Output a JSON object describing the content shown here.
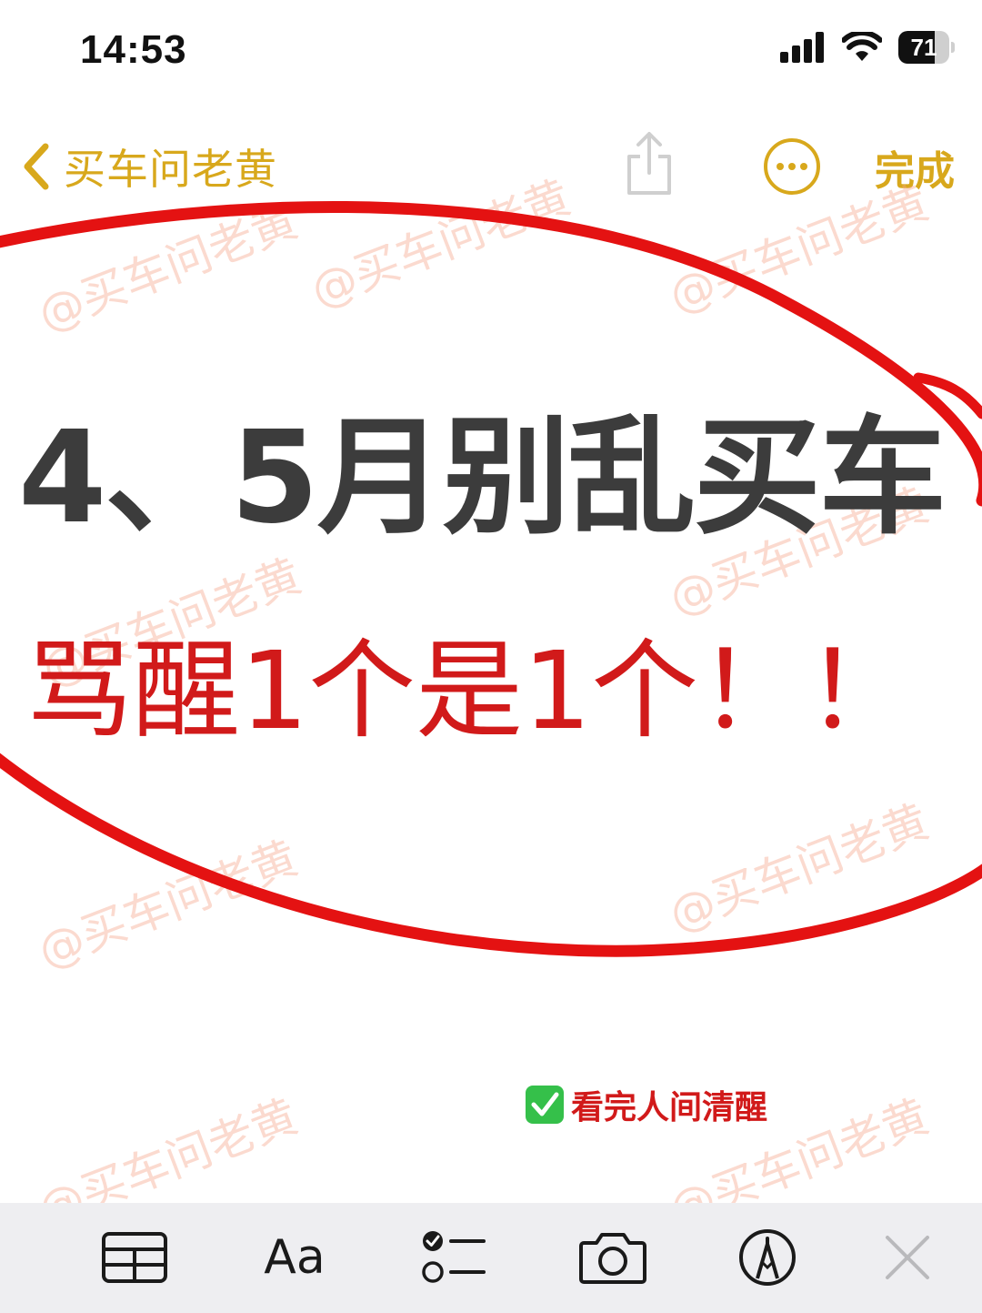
{
  "status_bar": {
    "time": "14:53",
    "battery_level": "71",
    "battery_fraction": 0.71,
    "icons": [
      "cellular-signal-icon",
      "wifi-icon",
      "battery-icon"
    ]
  },
  "nav": {
    "back_label": "买车问老黄",
    "done_label": "完成",
    "icons": [
      "chevron-left-icon",
      "share-icon",
      "more-icon"
    ]
  },
  "note": {
    "headline": "4、5月别乱买车",
    "subline": "骂醒1个是1个！！",
    "footnote": "看完人间清醒",
    "footnote_icon": "check-mark-button-icon"
  },
  "watermark": {
    "text": "@买车问老黄"
  },
  "toolbar": {
    "format_label": "Aa",
    "icons": [
      "table-icon",
      "format-text-icon",
      "checklist-icon",
      "camera-icon",
      "markup-pen-icon",
      "close-icon"
    ]
  },
  "colors": {
    "accent": "#d8a81c",
    "headline": "#3c3c3c",
    "red": "#d11a1a",
    "ellipse": "#e41212",
    "check_green": "#35c04a",
    "toolbar_bg": "#eeeef1",
    "watermark": "#f5a88c"
  }
}
